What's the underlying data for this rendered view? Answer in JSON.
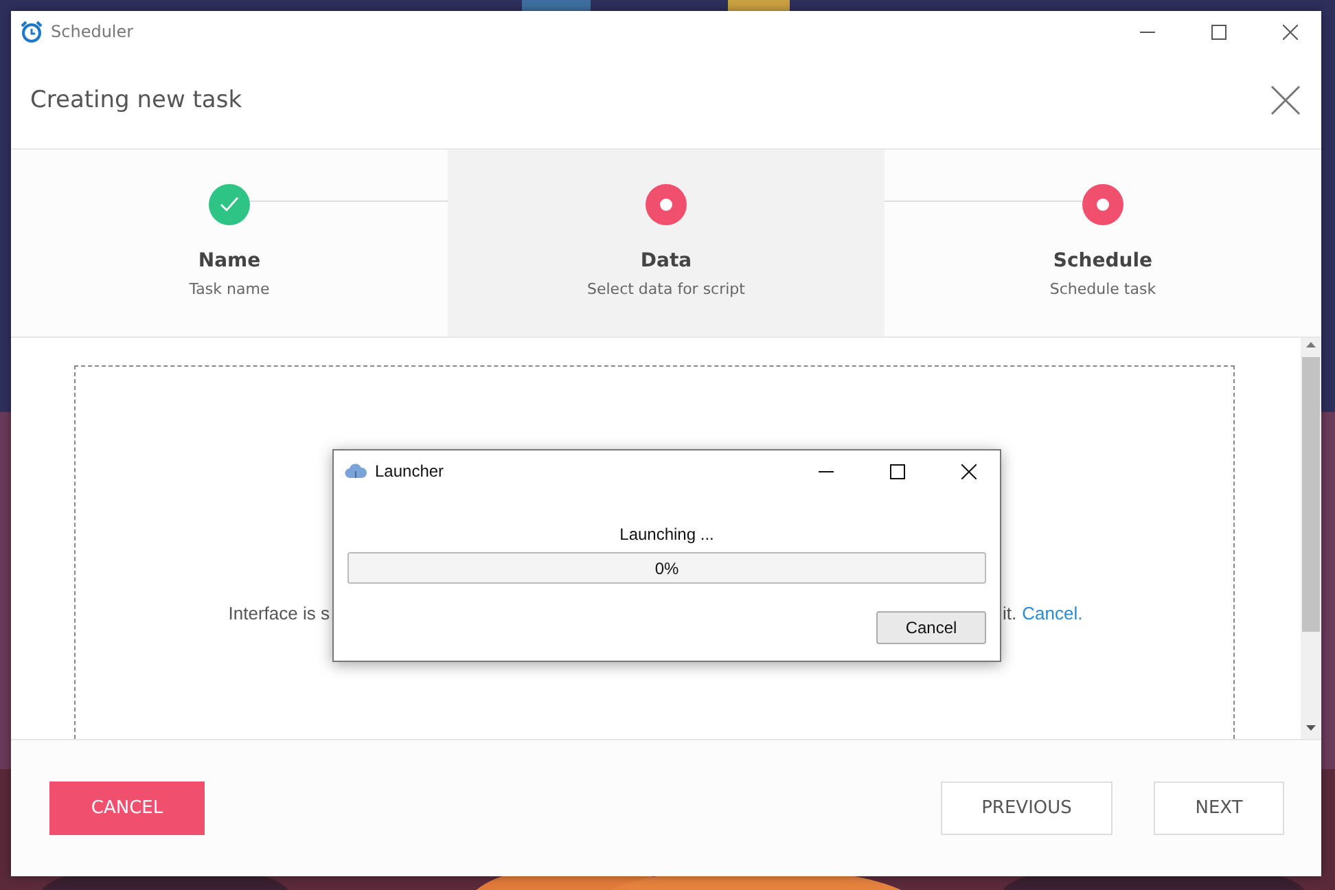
{
  "window": {
    "title": "Scheduler"
  },
  "header": {
    "title": "Creating new task"
  },
  "steps": [
    {
      "title": "Name",
      "subtitle": "Task name",
      "done": true,
      "selected": false
    },
    {
      "title": "Data",
      "subtitle": "Select data for script",
      "done": false,
      "selected": true
    },
    {
      "title": "Schedule",
      "subtitle": "Schedule task",
      "done": false,
      "selected": false
    }
  ],
  "content": {
    "message_start": "Interface is s",
    "message_end": "it.",
    "link": "Cancel."
  },
  "dialog": {
    "title": "Launcher",
    "message": "Launching ...",
    "progress": {
      "level": 0,
      "reading": "0%"
    },
    "button": "Cancel"
  },
  "footer": {
    "cancel": "CANCEL",
    "previous": "PREVIOUS",
    "next": "NEXT"
  }
}
